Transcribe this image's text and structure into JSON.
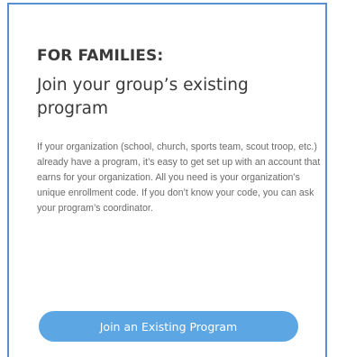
{
  "section": {
    "eyebrow": "FOR FAMILIES:",
    "headline": "Join your group’s existing program",
    "body": "If your organization (school, church, sports team, scout troop, etc.) already have a program, it’s easy to get set up with an account that earns for your organization. All you need is your organization’s unique enrollment code. If you don’t know your code, you can ask your program’s coordinator.",
    "cta_label": "Join an Existing Program"
  },
  "colors": {
    "accent_border": "#5b8fd0",
    "button_background": "#5ba6e3",
    "button_text": "#ffffff",
    "heading_text": "#3a3a3a",
    "body_text": "#6a6a6a"
  }
}
